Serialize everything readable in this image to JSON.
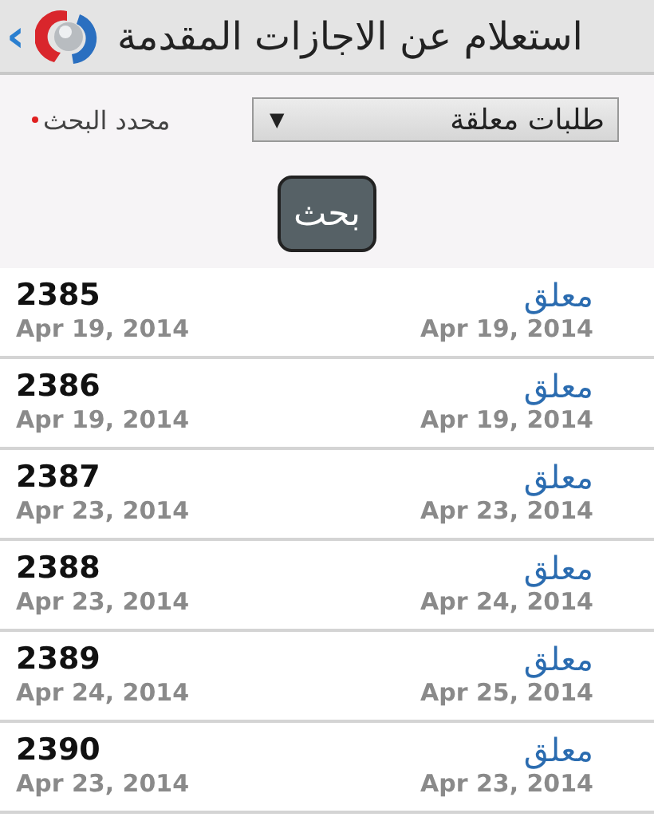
{
  "header": {
    "title": "استعلام عن الاجازات المقدمة",
    "back": "‹"
  },
  "filter": {
    "label": "محدد البحث",
    "required": true,
    "value": "طلبات معلقة",
    "arrow": "▼"
  },
  "search_button": "بحث",
  "rows": [
    {
      "number": "2385",
      "date_left": "Apr 19, 2014",
      "status": "معلق",
      "date_right": "Apr 19, 2014"
    },
    {
      "number": "2386",
      "date_left": "Apr 19, 2014",
      "status": "معلق",
      "date_right": "Apr 19, 2014"
    },
    {
      "number": "2387",
      "date_left": "Apr 23, 2014",
      "status": "معلق",
      "date_right": "Apr 23, 2014"
    },
    {
      "number": "2388",
      "date_left": "Apr 23, 2014",
      "status": "معلق",
      "date_right": "Apr 24, 2014"
    },
    {
      "number": "2389",
      "date_left": "Apr 24, 2014",
      "status": "معلق",
      "date_right": "Apr 25, 2014"
    },
    {
      "number": "2390",
      "date_left": "Apr 23, 2014",
      "status": "معلق",
      "date_right": "Apr 23, 2014"
    }
  ]
}
